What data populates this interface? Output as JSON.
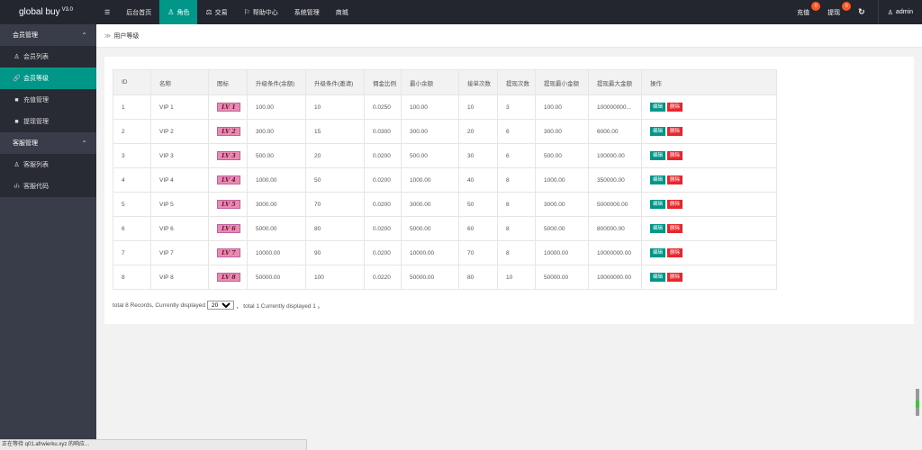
{
  "app": {
    "brand": "global buy",
    "version": "V3.0"
  },
  "topnav": {
    "menu_icon": "hamburger-icon",
    "items": [
      {
        "label": "后台首页",
        "icon": ""
      },
      {
        "label": "角色",
        "icon": "user-icon"
      },
      {
        "label": "交易",
        "icon": "scale-icon"
      },
      {
        "label": "帮助中心",
        "icon": "flag-icon"
      },
      {
        "label": "系统管理",
        "icon": ""
      },
      {
        "label": "商城",
        "icon": ""
      }
    ],
    "right": {
      "recharge_label": "充值",
      "recharge_count": "0",
      "withdraw_label": "提现",
      "withdraw_count": "0",
      "refresh_icon": "refresh-icon",
      "user": "admin"
    }
  },
  "sidebar": {
    "groups": [
      {
        "label": "会员管理",
        "items": [
          {
            "label": "会员列表",
            "icon": "user-icon"
          },
          {
            "label": "会员等级",
            "icon": "link-icon"
          },
          {
            "label": "充值管理",
            "icon": "comment-icon"
          },
          {
            "label": "提现管理",
            "icon": "comment-icon"
          }
        ]
      },
      {
        "label": "客服管理",
        "items": [
          {
            "label": "客服列表",
            "icon": "users-icon"
          },
          {
            "label": "客服代码",
            "icon": "code-icon"
          }
        ]
      }
    ]
  },
  "breadcrumb": {
    "current": "用户等级"
  },
  "table": {
    "headers": [
      "ID",
      "名称",
      "图标",
      "升级条件(余额)",
      "升级条件(邀请)",
      "佣金比例",
      "最小余额",
      "接单次数",
      "提现次数",
      "提现最小金额",
      "提现最大金额",
      "操作"
    ],
    "edit_label": "编辑",
    "delete_label": "删除",
    "rows": [
      {
        "id": "1",
        "name": "VIP 1",
        "lv": "LV 1",
        "up_balance": "100.00",
        "up_invite": "10",
        "commission": "0.0250",
        "min_balance": "100.00",
        "orders": "10",
        "withdraw_times": "3",
        "wd_min": "100.00",
        "wd_max": "100000000..."
      },
      {
        "id": "2",
        "name": "VIP 2",
        "lv": "LV 2",
        "up_balance": "300.00",
        "up_invite": "15",
        "commission": "0.0300",
        "min_balance": "300.00",
        "orders": "20",
        "withdraw_times": "6",
        "wd_min": "300.00",
        "wd_max": "6000.00"
      },
      {
        "id": "3",
        "name": "VIP 3",
        "lv": "LV 3",
        "up_balance": "500.00",
        "up_invite": "20",
        "commission": "0.0200",
        "min_balance": "500.00",
        "orders": "30",
        "withdraw_times": "6",
        "wd_min": "500.00",
        "wd_max": "100000.00"
      },
      {
        "id": "4",
        "name": "VIP 4",
        "lv": "LV 4",
        "up_balance": "1000.00",
        "up_invite": "50",
        "commission": "0.0200",
        "min_balance": "1000.00",
        "orders": "40",
        "withdraw_times": "8",
        "wd_min": "1000.00",
        "wd_max": "350000.00"
      },
      {
        "id": "5",
        "name": "VIP 5",
        "lv": "LV 5",
        "up_balance": "3000.00",
        "up_invite": "70",
        "commission": "0.0200",
        "min_balance": "3000.00",
        "orders": "50",
        "withdraw_times": "8",
        "wd_min": "3000.00",
        "wd_max": "5000000.00"
      },
      {
        "id": "6",
        "name": "VIP 6",
        "lv": "LV 6",
        "up_balance": "5000.00",
        "up_invite": "80",
        "commission": "0.0200",
        "min_balance": "5000.00",
        "orders": "60",
        "withdraw_times": "8",
        "wd_min": "5000.00",
        "wd_max": "800000.00"
      },
      {
        "id": "7",
        "name": "VIP 7",
        "lv": "LV 7",
        "up_balance": "10000.00",
        "up_invite": "90",
        "commission": "0.0200",
        "min_balance": "10000.00",
        "orders": "70",
        "withdraw_times": "8",
        "wd_min": "10000.00",
        "wd_max": "10000000.00"
      },
      {
        "id": "8",
        "name": "VIP 8",
        "lv": "LV 8",
        "up_balance": "50000.00",
        "up_invite": "100",
        "commission": "0.0220",
        "min_balance": "50000.00",
        "orders": "80",
        "withdraw_times": "10",
        "wd_min": "50000.00",
        "wd_max": "10000000.00"
      }
    ]
  },
  "pager": {
    "prefix": "total 8 Records,  Currently displayed",
    "page_size": "20",
    "suffix": "，  total 1 Currently displayed 1  。"
  },
  "status_bar": "正在等待 q01.afrwierku.xyz 的响应...",
  "colors": {
    "accent": "#009688",
    "topbar": "#23262e",
    "sidebar": "#393d49",
    "delete": "#e8272d",
    "badge": "#ff5722"
  }
}
